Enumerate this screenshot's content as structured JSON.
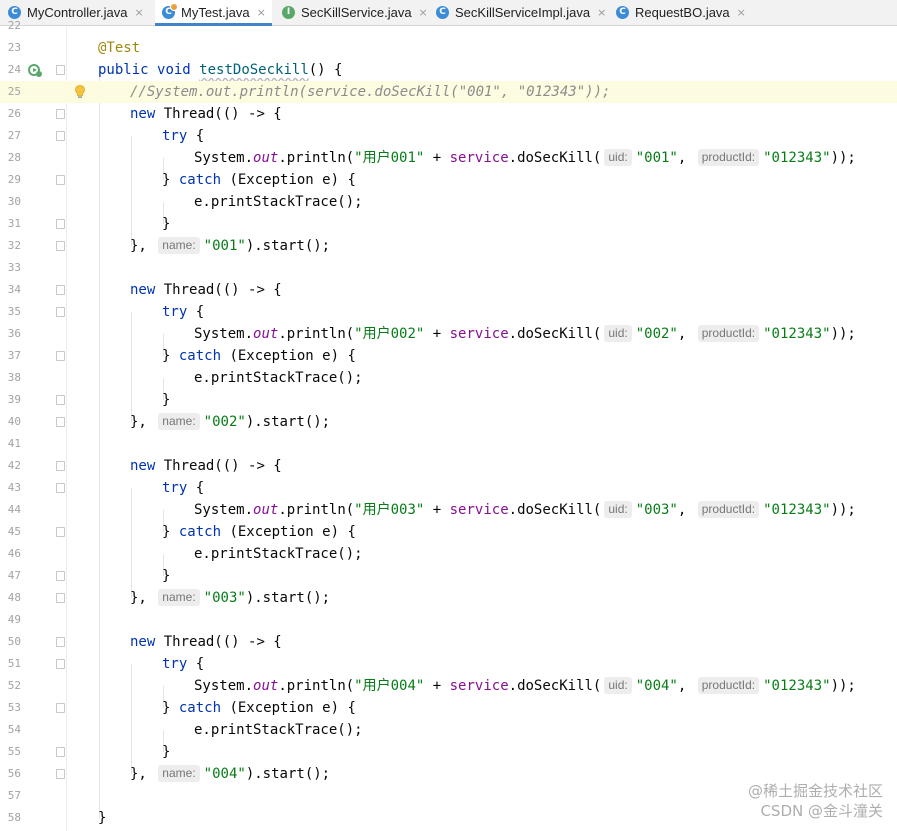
{
  "tabs": [
    {
      "label": "MyController.java",
      "icon": "C"
    },
    {
      "label": "MyTest.java",
      "icon": "C"
    },
    {
      "label": "SecKillService.java",
      "icon": "I"
    },
    {
      "label": "SecKillServiceImpl.java",
      "icon": "C"
    },
    {
      "label": "RequestBO.java",
      "icon": "C"
    }
  ],
  "close_glyph": "×",
  "lines": {
    "l22": "22",
    "l23": "23",
    "l24": "24",
    "l25": "25",
    "l26": "26",
    "l27": "27",
    "l28": "28",
    "l29": "29",
    "l30": "30",
    "l31": "31",
    "l32": "32",
    "l33": "33",
    "l34": "34",
    "l35": "35",
    "l36": "36",
    "l37": "37",
    "l38": "38",
    "l39": "39",
    "l40": "40",
    "l41": "41",
    "l42": "42",
    "l43": "43",
    "l44": "44",
    "l45": "45",
    "l46": "46",
    "l47": "47",
    "l48": "48",
    "l49": "49",
    "l50": "50",
    "l51": "51",
    "l52": "52",
    "l53": "53",
    "l54": "54",
    "l55": "55",
    "l56": "56",
    "l57": "57",
    "l58": "58"
  },
  "code": {
    "annotation": "@Test",
    "kw_public": "public",
    "kw_void": "void",
    "method_name": "testDoSeckill",
    "method_tail": "() {",
    "comment": "//System.out.println(service.doSecKill(\"001\", \"012343\"));",
    "kw_new": "new",
    "thread_open": "Thread(() -> {",
    "kw_try": "try",
    "brace_open": " {",
    "system": "System.",
    "out": "out",
    "println_open": ".println(",
    "plus": " + ",
    "service": "service",
    "doseckill": ".doSecKill(",
    "hint_uid": "uid:",
    "hint_product": "productId:",
    "hint_name": "name:",
    "comma": ",",
    "product_value": "\"012343\"",
    "call_close": "));",
    "catch_close": "} ",
    "kw_catch": "catch",
    "catch_tail": " (Exception e) {",
    "print_stack": "e.printStackTrace();",
    "close_brace": "}",
    "thread_close": "},",
    "start_tail": ").start();",
    "blocks": [
      {
        "user": "\"用户001\"",
        "id": "\"001\""
      },
      {
        "user": "\"用户002\"",
        "id": "\"002\""
      },
      {
        "user": "\"用户003\"",
        "id": "\"003\""
      },
      {
        "user": "\"用户004\"",
        "id": "\"004\""
      }
    ]
  },
  "watermark": {
    "line1": "@稀土掘金技术社区",
    "line2": "CSDN @金斗潼关"
  },
  "colors": {
    "keyword": "#0033b3",
    "string": "#067d17",
    "annotation": "#9e880d",
    "method": "#00627a",
    "field": "#871094",
    "comment": "#8c8c8c",
    "tab_accent": "#4083c9",
    "current_line": "#fdfce0"
  },
  "icons": {
    "run_gutter": "run-test-gutter-icon",
    "bulb": "intention-bulb-icon",
    "class_file": "java-class-icon",
    "interface_file": "java-interface-icon"
  }
}
